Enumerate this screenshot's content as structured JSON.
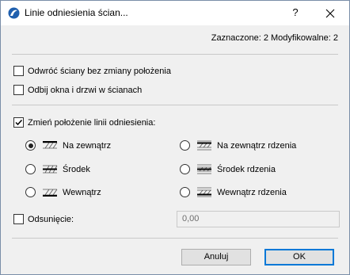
{
  "window": {
    "title": "Linie odniesienia ścian...",
    "help_label": "?"
  },
  "summary": "Zaznaczone: 2 Modyfikowalne: 2",
  "options": {
    "flip_walls": {
      "label": "Odwróć ściany bez zmiany położenia",
      "checked": false
    },
    "mirror_openings": {
      "label": "Odbij okna i drzwi w ścianach",
      "checked": false
    },
    "change_reference": {
      "label": "Zmień położenie linii odniesienia:",
      "checked": true
    }
  },
  "reference_positions": [
    {
      "label": "Na zewnątrz",
      "selected": true
    },
    {
      "label": "Na zewnątrz rdzenia",
      "selected": false
    },
    {
      "label": "Środek",
      "selected": false
    },
    {
      "label": "Środek rdzenia",
      "selected": false
    },
    {
      "label": "Wewnątrz",
      "selected": false
    },
    {
      "label": "Wewnątrz rdzenia",
      "selected": false
    }
  ],
  "offset": {
    "label": "Odsunięcie:",
    "checked": false,
    "value": "0,00"
  },
  "buttons": {
    "cancel": "Anuluj",
    "ok": "OK"
  }
}
